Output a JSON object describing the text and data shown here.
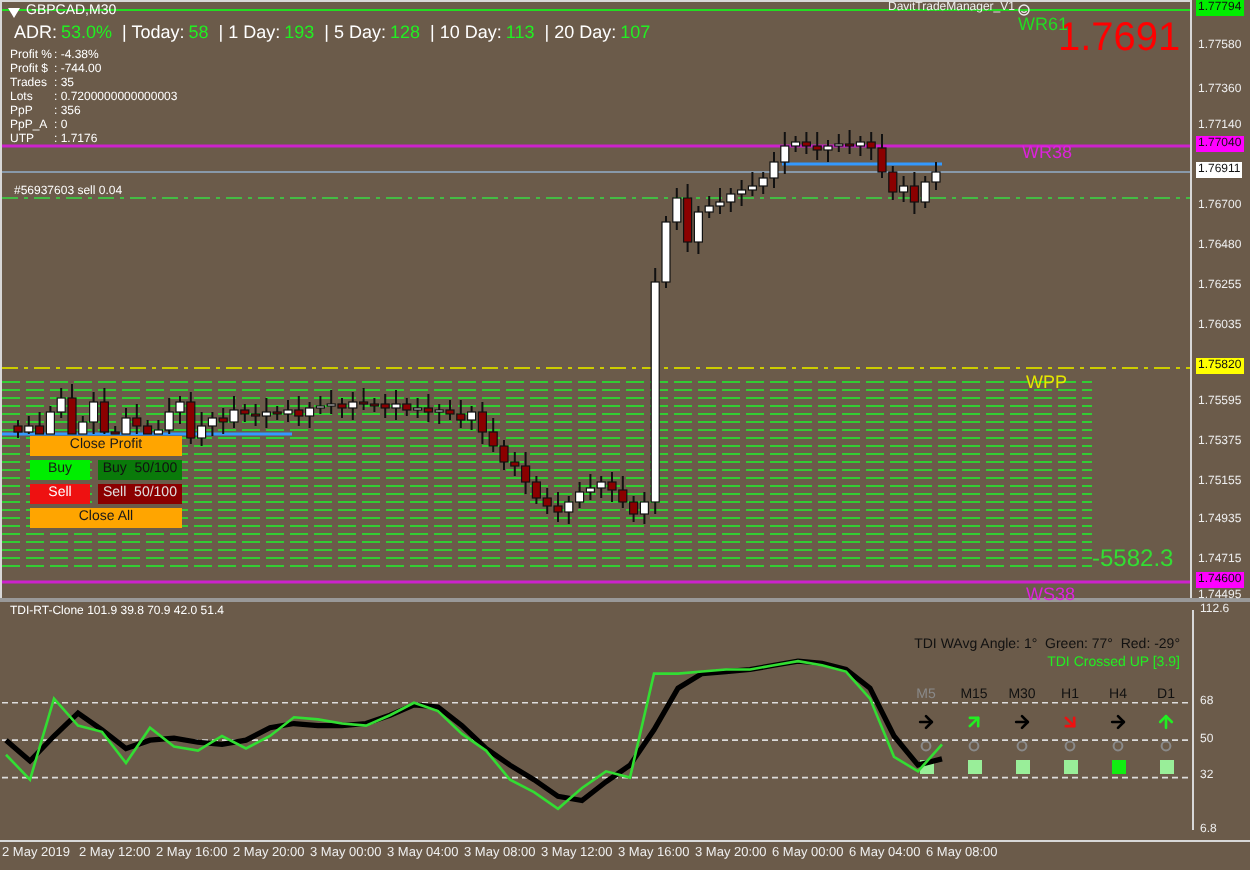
{
  "chart_header": {
    "symbol": "GBPCAD,M30"
  },
  "adr": [
    {
      "label": "ADR:",
      "value": "53.0%"
    },
    {
      "label": "| Today:",
      "value": "58"
    },
    {
      "label": "| 1 Day:",
      "value": "193"
    },
    {
      "label": "| 5 Day:",
      "value": "128"
    },
    {
      "label": "| 10 Day:",
      "value": "113"
    },
    {
      "label": "| 20 Day:",
      "value": "107"
    }
  ],
  "stats": [
    {
      "label": "Profit %",
      "value": ": -4.38%"
    },
    {
      "label": "Profit $",
      "value": ": -744.00"
    },
    {
      "label": "Trades",
      "value": ": 35"
    },
    {
      "label": "Lots",
      "value": ": 0.7200000000000003"
    },
    {
      "label": "PpP",
      "value": ": 356"
    },
    {
      "label": "PpP_A",
      "value": ": 0"
    },
    {
      "label": "UTP",
      "value": ": 1.7176"
    }
  ],
  "order_line": "#56937603 sell 0.04",
  "ea_name": "DavitTradeManager_V1",
  "price_big": "1.7691",
  "balance": "-5582.3",
  "levels": [
    {
      "label": "WR61",
      "color": "#22dd22"
    },
    {
      "label": "WR38",
      "color": "#dd22dd"
    },
    {
      "label": "WPP",
      "color": "#e6e600"
    },
    {
      "label": "WS38",
      "color": "#dd22dd"
    }
  ],
  "buttons": [
    {
      "label": "Close Profit",
      "kind": "close"
    },
    {
      "label": "Buy",
      "kind": "buy"
    },
    {
      "label": "Buy  50/100",
      "kind": "buy_part"
    },
    {
      "label": "Sell",
      "kind": "sell"
    },
    {
      "label": "Sell  50/100",
      "kind": "sell_part"
    },
    {
      "label": "Close All",
      "kind": "close"
    }
  ],
  "price_axis": [
    {
      "label": "1.77794",
      "color": "#00ee00"
    },
    {
      "label": "1.77580"
    },
    {
      "label": "1.77360"
    },
    {
      "label": "1.77140"
    },
    {
      "label": "1.77040",
      "color": "#ff00ff"
    },
    {
      "label": "1.76911",
      "color": "#ffffff"
    },
    {
      "label": "1.76700"
    },
    {
      "label": "1.76480"
    },
    {
      "label": "1.76255"
    },
    {
      "label": "1.76035"
    },
    {
      "label": "1.75820",
      "color": "#ffff00"
    },
    {
      "label": "1.75595"
    },
    {
      "label": "1.75375"
    },
    {
      "label": "1.75155"
    },
    {
      "label": "1.74935"
    },
    {
      "label": "1.74715"
    },
    {
      "label": "1.74600",
      "color": "#ff00ff"
    },
    {
      "label": "1.74495"
    }
  ],
  "indicator": {
    "title": "TDI-RT-Clone 101.9 39.8 70.9 42.0 51.4",
    "angle_text": "TDI WAvg Angle: 1°  Green: 77°  Red: -29°",
    "signal": "TDI Crossed UP [3.9]",
    "timeframes": [
      {
        "label": "M5",
        "disabled": true,
        "arrow": {
          "kind": "right",
          "color": "#000000"
        },
        "square": {
          "color": "#99ee99"
        }
      },
      {
        "label": "M15",
        "disabled": false,
        "arrow": {
          "kind": "up_right",
          "color": "#22ee22"
        },
        "square": {
          "color": "#99ee99"
        }
      },
      {
        "label": "M30",
        "disabled": false,
        "arrow": {
          "kind": "right",
          "color": "#000000"
        },
        "square": {
          "color": "#99ee99"
        }
      },
      {
        "label": "H1",
        "disabled": false,
        "arrow": {
          "kind": "down_right",
          "color": "#ee1111"
        },
        "square": {
          "color": "#99ee99"
        }
      },
      {
        "label": "H4",
        "disabled": false,
        "arrow": {
          "kind": "right",
          "color": "#000000"
        },
        "square": {
          "color": "#11ee11"
        }
      },
      {
        "label": "D1",
        "disabled": false,
        "arrow": {
          "kind": "up",
          "color": "#22ee22"
        },
        "square": {
          "color": "#99ee99"
        }
      }
    ],
    "chart_data": {
      "type": "line",
      "grid": true,
      "ylim": [
        6.8,
        112.6
      ],
      "yticks": [
        {
          "value": 6.8,
          "label": "6.8"
        },
        {
          "value": 32,
          "label": "32"
        },
        {
          "value": 50,
          "label": "50"
        },
        {
          "value": 68,
          "label": "68"
        },
        {
          "value": 112.6,
          "label": "112.6"
        }
      ],
      "series": [
        {
          "color": "#33dd33",
          "values": [
            43,
            31,
            70,
            57,
            54,
            39,
            56,
            47,
            45,
            52,
            46,
            52,
            61,
            60,
            58,
            57,
            62,
            68,
            64,
            53,
            45,
            31,
            25,
            17,
            27,
            35,
            32,
            82,
            82,
            83,
            84,
            84,
            86,
            88,
            86,
            83,
            70,
            42,
            35,
            48
          ]
        },
        {
          "color": "#000000",
          "values": [
            50,
            40,
            52,
            63,
            55,
            46,
            50,
            51,
            49,
            48,
            50,
            56,
            58,
            57,
            57,
            58,
            62,
            67,
            66,
            57,
            46,
            38,
            31,
            23,
            21,
            30,
            38,
            55,
            75,
            82,
            83,
            84,
            86,
            88,
            87,
            84,
            75,
            52,
            38,
            41
          ]
        }
      ]
    }
  },
  "time_axis": [
    "2 May 2019",
    "2 May 12:00",
    "2 May 16:00",
    "2 May 20:00",
    "3 May 00:00",
    "3 May 04:00",
    "3 May 08:00",
    "3 May 12:00",
    "3 May 16:00",
    "3 May 20:00",
    "6 May 00:00",
    "6 May 04:00",
    "6 May 08:00"
  ]
}
